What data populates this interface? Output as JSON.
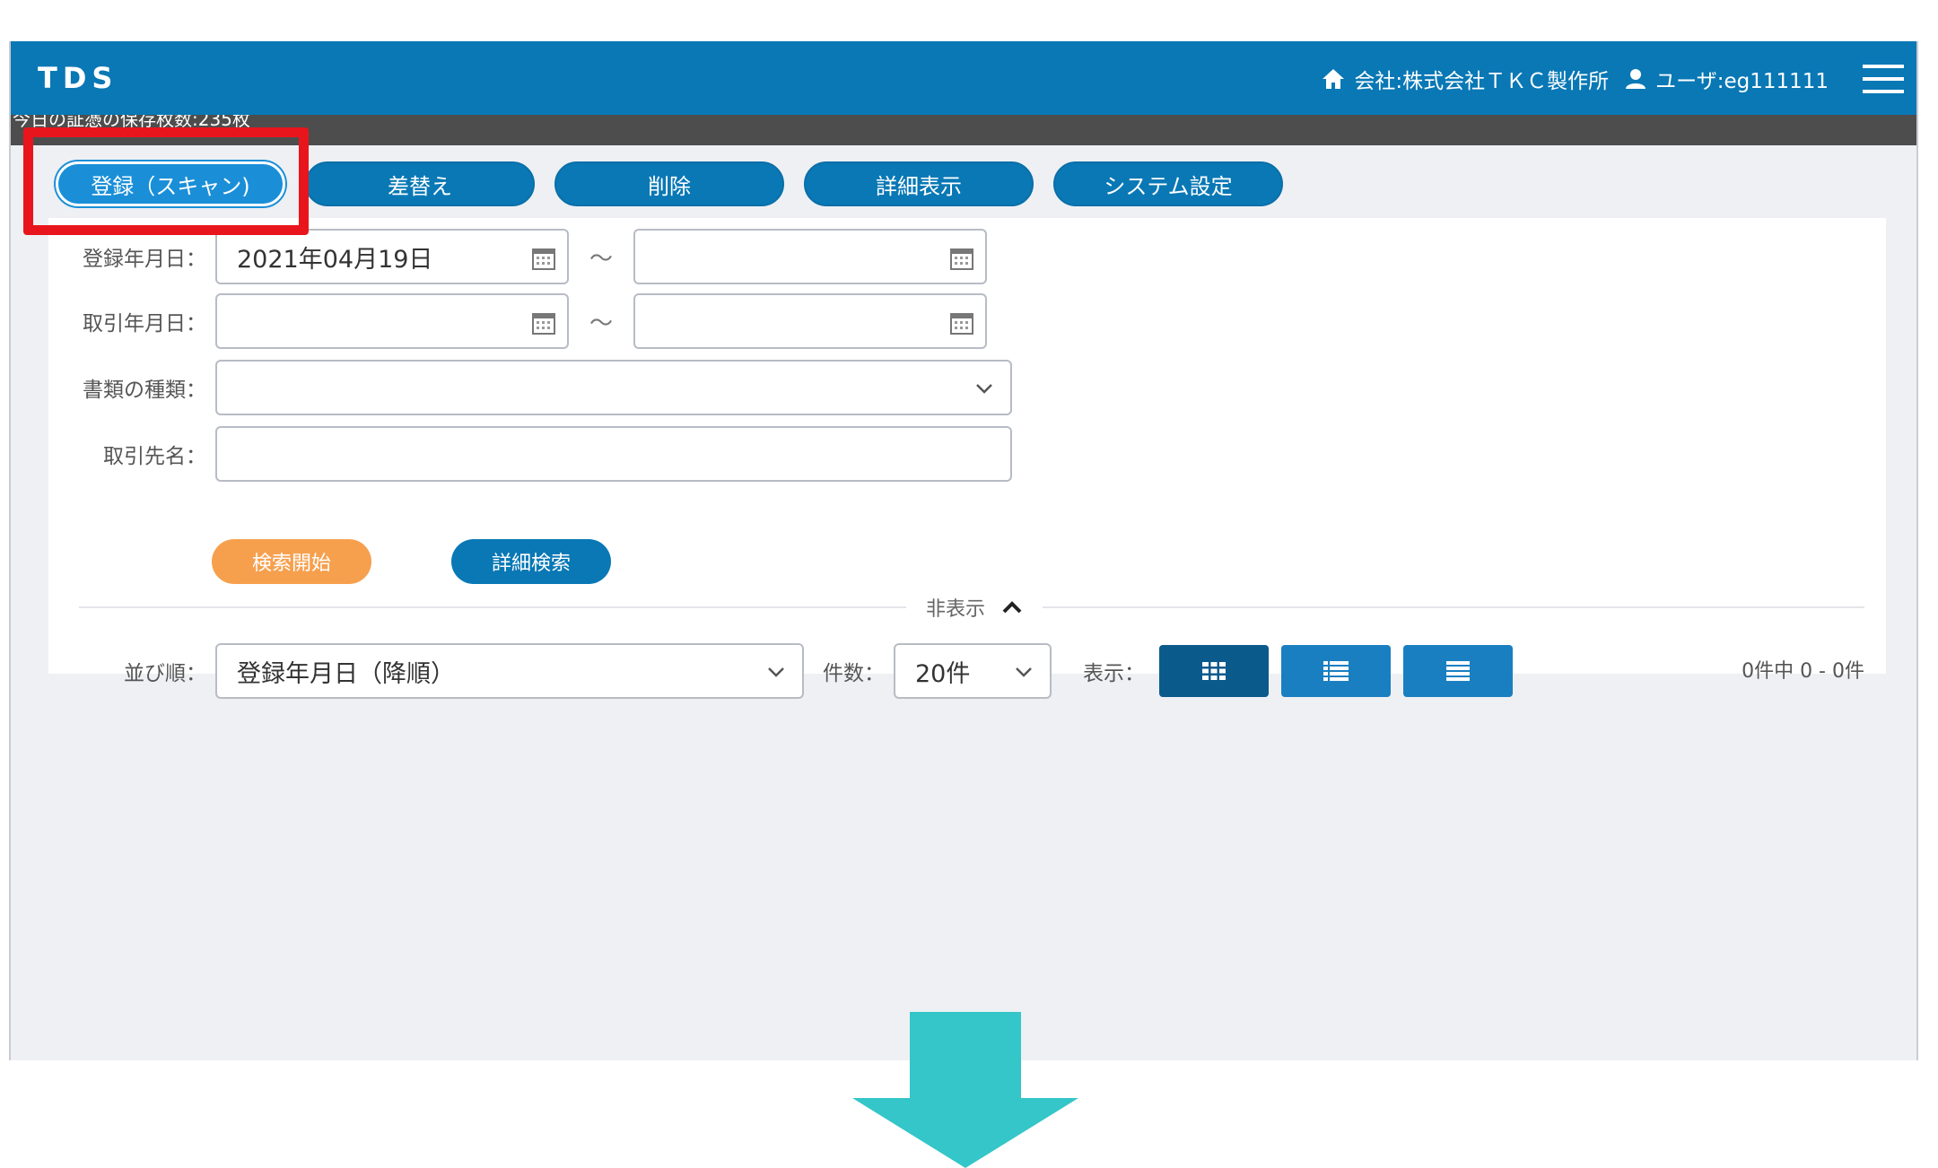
{
  "app": {
    "logo": "TDS",
    "company": "会社:株式会社ＴＫＣ製作所",
    "user": "ユーザ:eg111111"
  },
  "status": {
    "text": "今日の証憑の保存枚数:235枚"
  },
  "toolbar": {
    "buttons": [
      {
        "label": "登録（スキャン)"
      },
      {
        "label": "差替え"
      },
      {
        "label": "削除"
      },
      {
        "label": "詳細表示"
      },
      {
        "label": "システム設定"
      }
    ]
  },
  "search": {
    "reg_date_label": "登録年月日：",
    "reg_date_from": "2021年04月19日",
    "reg_date_to": "",
    "tx_date_label": "取引年月日：",
    "tx_date_from": "",
    "tx_date_to": "",
    "tilde": "〜",
    "doc_type_label": "書類の種類：",
    "doc_type_value": "",
    "partner_label": "取引先名：",
    "partner_value": "",
    "search_button": "検索開始",
    "advanced_button": "詳細検索",
    "hide_toggle": "非表示"
  },
  "list": {
    "sort_label": "並び順：",
    "sort_value": "登録年月日（降順）",
    "count_label": "件数：",
    "count_value": "20件",
    "view_label": "表示：",
    "result_count": "0件中 0 - 0件"
  },
  "colors": {
    "header": "#0978b5",
    "status_bar": "#4d4d4d",
    "highlight": "#e8161c",
    "search_button": "#f6a04e",
    "arrow": "#34c6c8"
  }
}
